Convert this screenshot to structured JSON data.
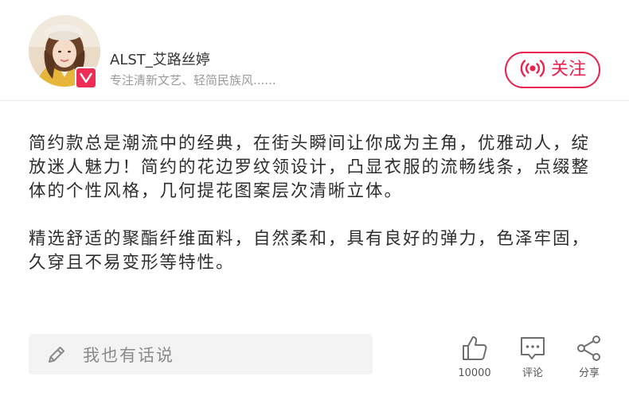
{
  "header": {
    "username": "ALST_艾路丝婷",
    "bio": "专注清新文艺、轻简民族风......",
    "follow_label": "关注",
    "avatar_icon": "avatar-photo",
    "badge_icon": "vip-v-icon",
    "follow_icon": "broadcast-icon",
    "accent_color": "#e8234e"
  },
  "content": {
    "paragraphs": [
      "简约款总是潮流中的经典，在街头瞬间让你成为主角，优雅动人，绽放迷人魅力！简约的花边罗纹领设计，凸显衣服的流畅线条，点缀整体的个性风格，几何提花图案层次清晰立体。",
      "精选舒适的聚酯纤维面料，自然柔和，具有良好的弹力，色泽牢固，久穿且不易变形等特性。"
    ]
  },
  "bottom_bar": {
    "comment_placeholder": "我也有话说",
    "pen_icon": "pen-icon",
    "like": {
      "icon": "thumbs-up-icon",
      "label": "10000"
    },
    "comment": {
      "icon": "comment-bubble-icon",
      "label": "评论"
    },
    "share": {
      "icon": "share-icon",
      "label": "分享"
    }
  }
}
